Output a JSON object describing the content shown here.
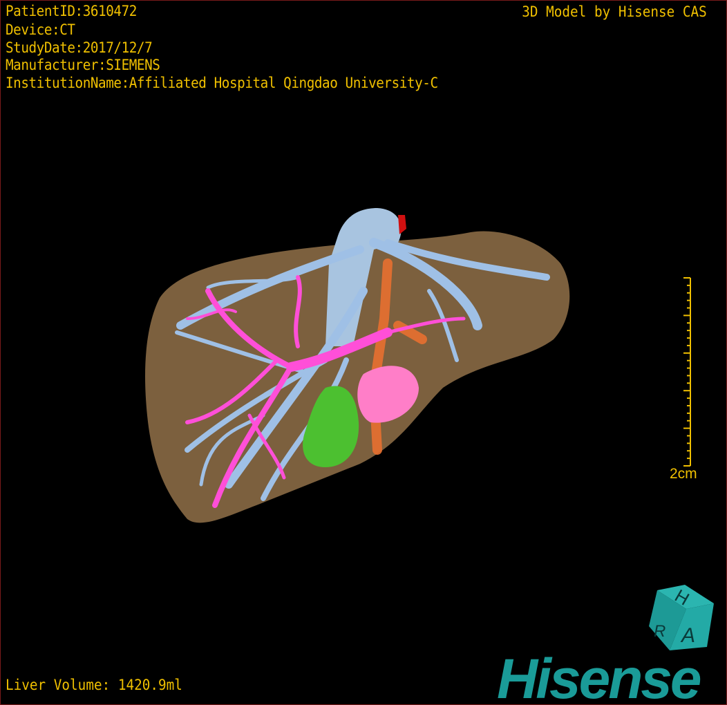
{
  "overlay": {
    "patient_id": "PatientID:3610472",
    "device": "Device:CT",
    "study_date": "StudyDate:2017/12/7",
    "manufacturer": "Manufacturer:SIEMENS",
    "institution": "InstitutionName:Affiliated Hospital Qingdao University-C",
    "title": "3D Model by Hisense CAS",
    "liver_volume": "Liver Volume: 1420.9ml"
  },
  "scale_bar": {
    "label": "2cm",
    "ticks": 25
  },
  "orientation_cube": {
    "faces": [
      "H",
      "R",
      "A"
    ]
  },
  "logo": "Hisense",
  "colors": {
    "text": "#f0c000",
    "liver": "#8a6a45",
    "hepatic_vein": "#9fc0e6",
    "portal_vein": "#ff4fd8",
    "gallbladder": "#4cc030",
    "artery": "#e87030",
    "pancreas_mass": "#ff7ec8",
    "logo": "#1a9b98"
  }
}
